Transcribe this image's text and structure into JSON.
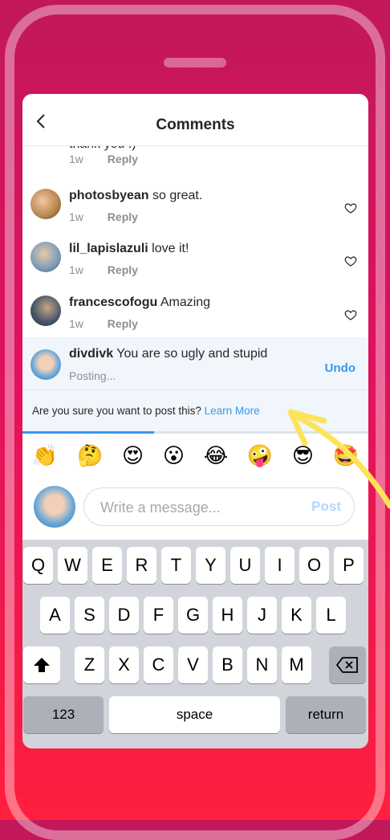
{
  "header": {
    "title": "Comments"
  },
  "partial_comment": {
    "text": "thank you :)",
    "time": "1w",
    "reply": "Reply"
  },
  "comments": [
    {
      "username": "photosbyean",
      "text": " so great.",
      "time": "1w",
      "reply": "Reply"
    },
    {
      "username": "lil_lapislazuli",
      "text": " love it!",
      "time": "1w",
      "reply": "Reply"
    },
    {
      "username": "francescofogu",
      "text": " Amazing",
      "time": "1w",
      "reply": "Reply"
    }
  ],
  "pending": {
    "username": "divdivk",
    "text": " You are so ugly and stupid",
    "status": "Posting...",
    "undo": "Undo",
    "warning": "Are you sure you want to post this?",
    "learn_more": "Learn More"
  },
  "emojis": [
    "👏",
    "🤔",
    "😍",
    "😮",
    "😂",
    "🤪",
    "😎",
    "🤩"
  ],
  "compose": {
    "placeholder": "Write a message...",
    "post": "Post"
  },
  "keyboard": {
    "row1": [
      "Q",
      "W",
      "E",
      "R",
      "T",
      "Y",
      "U",
      "I",
      "O",
      "P"
    ],
    "row2": [
      "A",
      "S",
      "D",
      "F",
      "G",
      "H",
      "J",
      "K",
      "L"
    ],
    "row3": [
      "Z",
      "X",
      "C",
      "V",
      "B",
      "N",
      "M"
    ],
    "numbers": "123",
    "space": "space",
    "return": "return"
  },
  "colors": {
    "accent": "#3897f0",
    "background_top": "#c2185b",
    "background_bottom": "#ff1f3d"
  }
}
